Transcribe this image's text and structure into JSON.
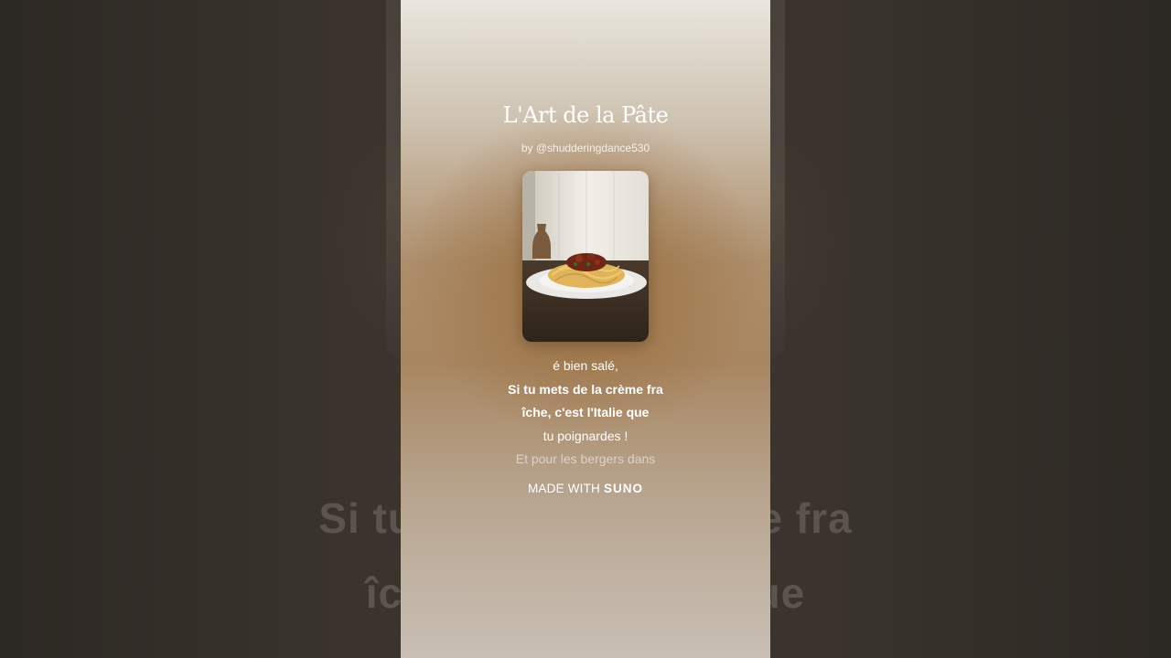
{
  "song": {
    "title": "L'Art de la Pâte",
    "author": "by @shudderingdance530"
  },
  "lyrics": {
    "lines": [
      "é bien salé,",
      "Si tu mets de la crème fra",
      "îche, c'est l'Italie que",
      "tu poignardes !",
      "Et pour les bergers dans"
    ]
  },
  "background": {
    "lyric_line_1": "Si tu mets de la crème fra",
    "lyric_line_2": "îche, c'est l'Italie que"
  },
  "footer": {
    "made_with": "MADE WITH",
    "brand": "SUNO"
  },
  "cover": {
    "icon": "spaghetti-plate-artwork"
  }
}
